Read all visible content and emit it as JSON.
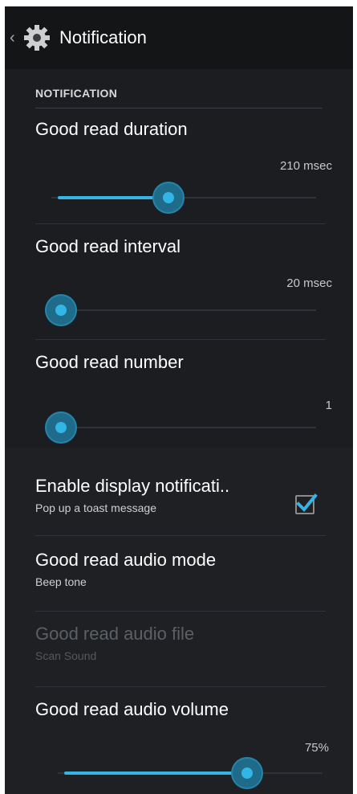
{
  "action_bar": {
    "back_icon": "chevron-left-icon",
    "app_icon": "gear-icon",
    "title": "Notification"
  },
  "section": {
    "header": "NOTIFICATION"
  },
  "sliders": [
    {
      "title": "Good read duration",
      "value_text": "210 msec",
      "level_percent": 45
    },
    {
      "title": "Good read interval",
      "value_text": "20 msec",
      "level_percent": 0
    },
    {
      "title": "Good read number",
      "value_text": "1",
      "level_percent": 0
    }
  ],
  "prefs": [
    {
      "title": "Enable display notificati..",
      "summary": "Pop up a toast message",
      "checked": true
    },
    {
      "title": "Good read audio mode",
      "summary": "Beep tone"
    },
    {
      "title": "Good read audio file",
      "summary": "Scan Sound",
      "enabled": false
    }
  ],
  "volume": {
    "title": "Good read audio volume",
    "value_text": "75%",
    "level_percent": 75
  },
  "colors": {
    "accent": "#33b5e5",
    "background": "#1b1d20"
  }
}
